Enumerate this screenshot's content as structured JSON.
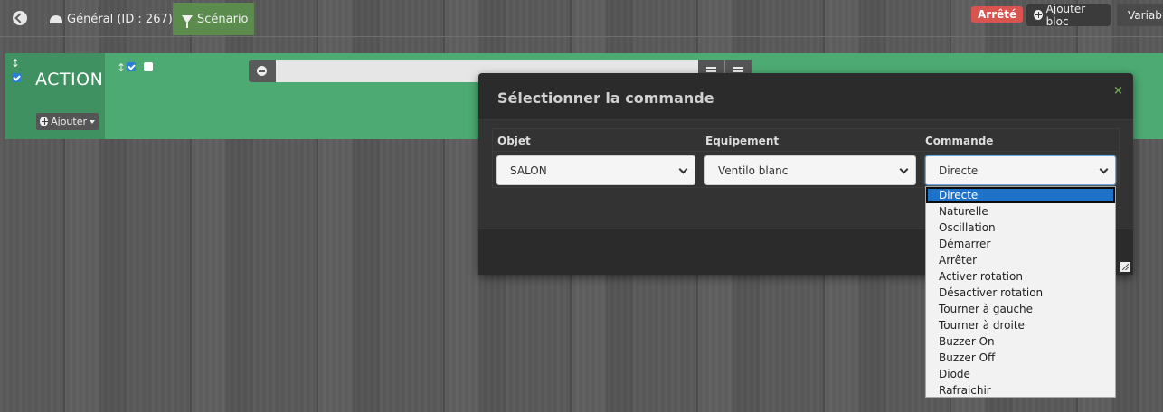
{
  "topbar": {
    "general_label": "Général (ID : 267)",
    "scenario_label": "Scénario",
    "status": "Arrêté",
    "add_block_label": "Ajouter bloc",
    "variables_label": "Variables"
  },
  "action_block": {
    "title": "ACTION",
    "add_label": "Ajouter",
    "command_value": ""
  },
  "modal": {
    "title": "Sélectionner la commande",
    "close_label": "×",
    "columns": [
      "Objet",
      "Equipement",
      "Commande"
    ],
    "object_value": "SALON",
    "equipment_value": "Ventilo blanc",
    "command_value": "Directe"
  },
  "command_options": [
    "Directe",
    "Naturelle",
    "Oscillation",
    "Démarrer",
    "Arrêter",
    "Activer rotation",
    "Désactiver rotation",
    "Tourner à gauche",
    "Tourner à droite",
    "Buzzer On",
    "Buzzer Off",
    "Diode",
    "Rafraichir"
  ],
  "colors": {
    "action_bg": "#4caa72",
    "scenario_tab": "#5b8c4e",
    "status_badge": "#d9534f",
    "selected_option": "#1e73c8"
  }
}
